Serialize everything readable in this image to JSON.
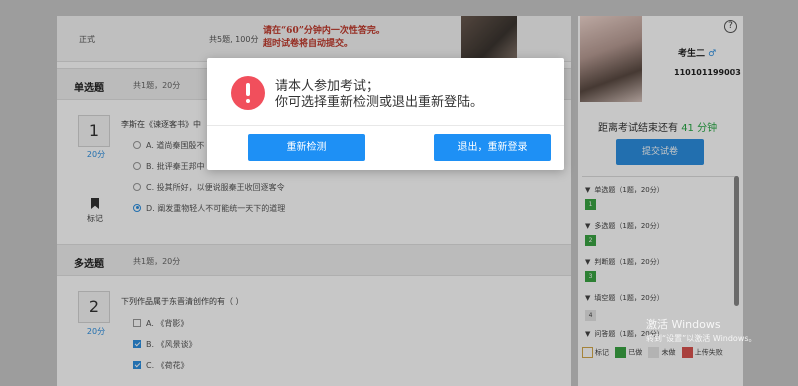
{
  "exam_header": {
    "type_tag": "正式",
    "question_count": "共5题, 100分",
    "warning_line1": "请在“60”分钟内一次性答完。",
    "warning_line2": "超时试卷将自动提交。"
  },
  "section1": {
    "title": "单选题",
    "meta": "共1题，20分",
    "q_number": "1",
    "q_score": "20分",
    "q_text": "李斯在《谏逐客书》中",
    "options": [
      {
        "label": "A.  道尚秦国殷不",
        "selected": false
      },
      {
        "label": "B.  批评秦王邦中",
        "selected": false
      },
      {
        "label": "C.  投其所好，以便说服秦王收回逐客令",
        "selected": false
      },
      {
        "label": "D.  阐发重物轻人不可能统一天下的道理",
        "selected": true
      }
    ],
    "mark_label": "标记"
  },
  "section2": {
    "title": "多选题",
    "meta": "共1题，20分",
    "q_number": "2",
    "q_score": "20分",
    "q_text": "下列作品属于东晋清创作的有（ ）",
    "options": [
      {
        "label": "A.  《背影》",
        "checked": false
      },
      {
        "label": "B.  《风景谈》",
        "checked": true
      },
      {
        "label": "C.  《荷花》",
        "checked": true
      }
    ]
  },
  "student": {
    "name": "考生二",
    "gender_symbol": "♂",
    "id": "110101199003",
    "id_suffix": "?",
    "help": "?"
  },
  "timer": {
    "prefix": "距离考试结束还有",
    "minutes": "41 分钟"
  },
  "submit_label": "提交试卷",
  "nav_groups": [
    {
      "label": "单选题（1题，20分）",
      "cells": [
        {
          "n": "1",
          "state": "answered"
        }
      ]
    },
    {
      "label": "多选题（1题，20分）",
      "cells": [
        {
          "n": "2",
          "state": "answered"
        }
      ]
    },
    {
      "label": "判断题（1题，20分）",
      "cells": [
        {
          "n": "3",
          "state": "answered"
        }
      ]
    },
    {
      "label": "填空题（1题，20分）",
      "cells": [
        {
          "n": "4",
          "state": "unanswered"
        }
      ]
    },
    {
      "label": "问答题（1题，20分）",
      "cells": []
    }
  ],
  "legend": {
    "mark": "标记",
    "answered": "已做",
    "unanswered": "未做",
    "upload_failed": "上传失败"
  },
  "colors": {
    "accent": "#1e90f5",
    "answered": "#3aa543",
    "unanswered": "#e6e6e6",
    "failed": "#d9534f",
    "alert": "#f14f5c"
  },
  "dialog": {
    "line1": "请本人参加考试；",
    "line2": "你可选择重新检测或退出重新登陆。",
    "btn_recheck": "重新检测",
    "btn_logout": "退出，重新登录"
  },
  "watermark": {
    "line1": "激活 Windows",
    "line2": "转到“设置”以激活 Windows。"
  }
}
